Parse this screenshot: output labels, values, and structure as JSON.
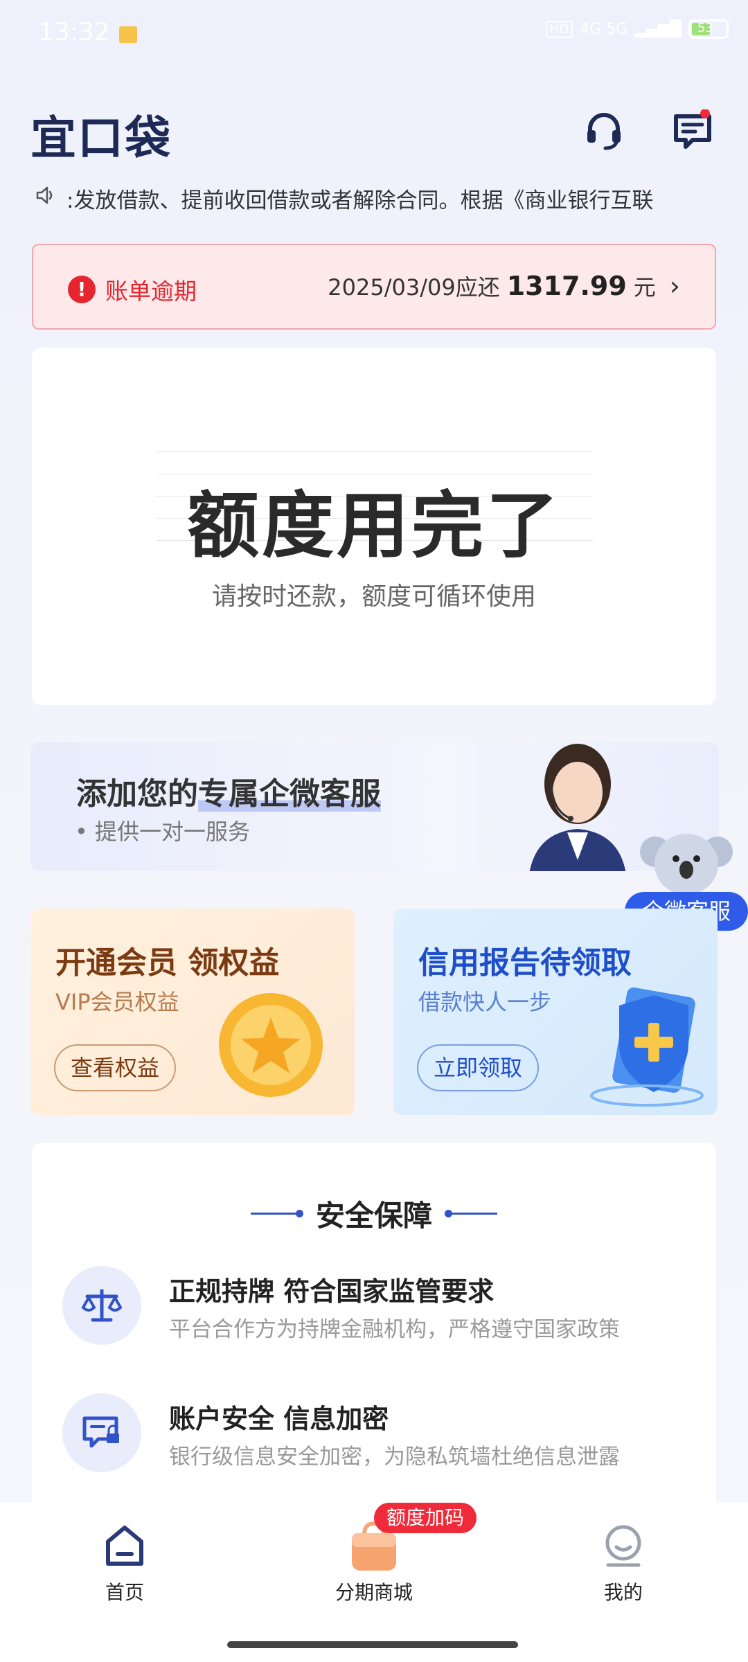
{
  "status_bar": {
    "time": "13:32",
    "network": "4G 5G",
    "battery": "53"
  },
  "header": {
    "logo": "宜口袋",
    "headset_icon": "headset-icon",
    "message_icon": "message-icon"
  },
  "notice": {
    "text": ":发放借款、提前收回借款或者解除合同。根据《商业银行互联"
  },
  "overdue": {
    "label": "账单逾期",
    "due_text": "2025/03/09应还",
    "amount": "1317.99",
    "unit": "元"
  },
  "credit": {
    "title": "额度用完了",
    "subtitle": "请按时还款，额度可循环使用"
  },
  "service_banner": {
    "title_plain": "添加您的",
    "title_highlight": "专属企微客服",
    "subtitle": "• 提供一对一服务",
    "badge": "企微客服"
  },
  "promos": [
    {
      "title": "开通会员 领权益",
      "subtitle": "VIP会员权益",
      "button": "查看权益"
    },
    {
      "title": "信用报告待领取",
      "subtitle": "借款快人一步",
      "button": "立即领取"
    }
  ],
  "safety": {
    "title": "安全保障",
    "features": [
      {
        "title": "正规持牌 符合国家监管要求",
        "desc": "平台合作方为持牌金融机构，严格遵守国家政策"
      },
      {
        "title": "账户安全 信息加密",
        "desc": "银行级信息安全加密，为隐私筑墙杜绝信息泄露"
      }
    ]
  },
  "tabbar": {
    "tabs": [
      {
        "label": "首页"
      },
      {
        "label": "分期商城"
      },
      {
        "label": "我的"
      }
    ],
    "mall_badge": "额度加码"
  },
  "colors": {
    "brand": "#1d2a55",
    "accent_blue": "#2f5be9",
    "alert_red": "#e5262f"
  }
}
